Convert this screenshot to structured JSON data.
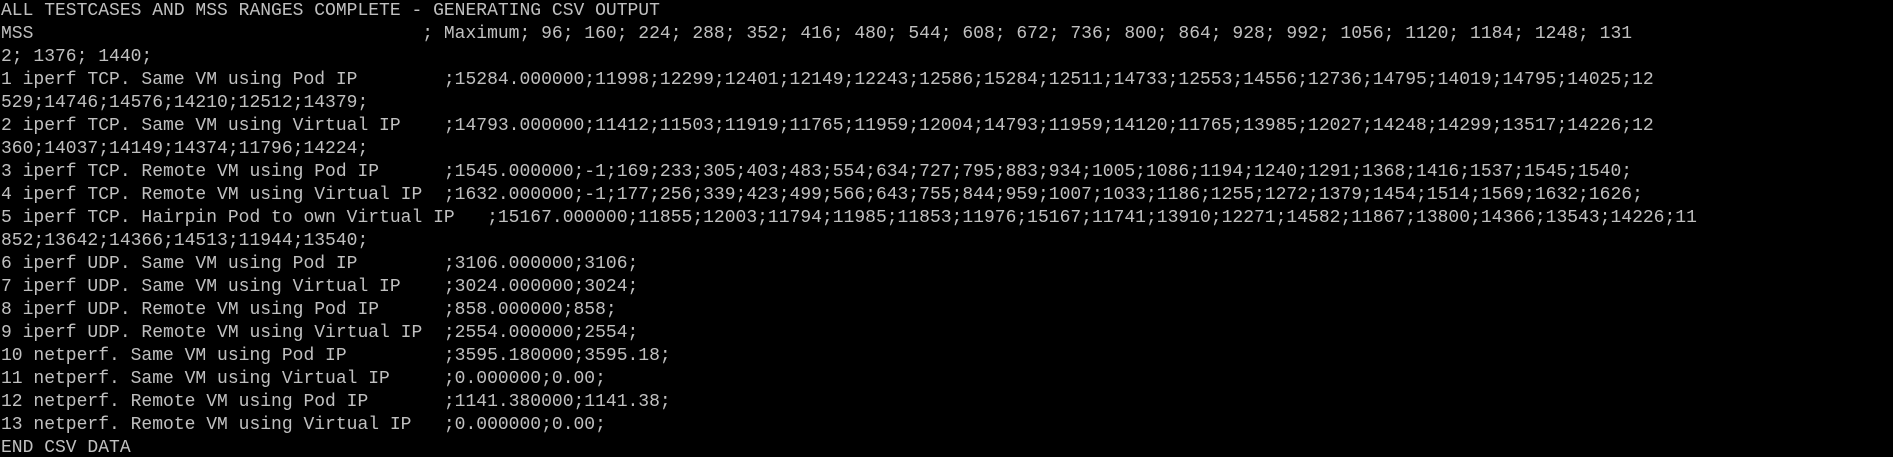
{
  "colors": {
    "background": "#000000",
    "text": "#c0c0c0"
  },
  "terminal": {
    "lines": [
      "ALL TESTCASES AND MSS RANGES COMPLETE - GENERATING CSV OUTPUT",
      "MSS                                    ; Maximum; 96; 160; 224; 288; 352; 416; 480; 544; 608; 672; 736; 800; 864; 928; 992; 1056; 1120; 1184; 1248; 131",
      "2; 1376; 1440;",
      "1 iperf TCP. Same VM using Pod IP        ;15284.000000;11998;12299;12401;12149;12243;12586;15284;12511;14733;12553;14556;12736;14795;14019;14795;14025;12",
      "529;14746;14576;14210;12512;14379;",
      "2 iperf TCP. Same VM using Virtual IP    ;14793.000000;11412;11503;11919;11765;11959;12004;14793;11959;14120;11765;13985;12027;14248;14299;13517;14226;12",
      "360;14037;14149;14374;11796;14224;",
      "3 iperf TCP. Remote VM using Pod IP      ;1545.000000;-1;169;233;305;403;483;554;634;727;795;883;934;1005;1086;1194;1240;1291;1368;1416;1537;1545;1540;",
      "4 iperf TCP. Remote VM using Virtual IP  ;1632.000000;-1;177;256;339;423;499;566;643;755;844;959;1007;1033;1186;1255;1272;1379;1454;1514;1569;1632;1626;",
      "5 iperf TCP. Hairpin Pod to own Virtual IP   ;15167.000000;11855;12003;11794;11985;11853;11976;15167;11741;13910;12271;14582;11867;13800;14366;13543;14226;11",
      "852;13642;14366;14513;11944;13540;",
      "6 iperf UDP. Same VM using Pod IP        ;3106.000000;3106;",
      "7 iperf UDP. Same VM using Virtual IP    ;3024.000000;3024;",
      "8 iperf UDP. Remote VM using Pod IP      ;858.000000;858;",
      "9 iperf UDP. Remote VM using Virtual IP  ;2554.000000;2554;",
      "10 netperf. Same VM using Pod IP         ;3595.180000;3595.18;",
      "11 netperf. Same VM using Virtual IP     ;0.000000;0.00;",
      "12 netperf. Remote VM using Pod IP       ;1141.380000;1141.38;",
      "13 netperf. Remote VM using Virtual IP   ;0.000000;0.00;",
      "END CSV DATA"
    ]
  }
}
